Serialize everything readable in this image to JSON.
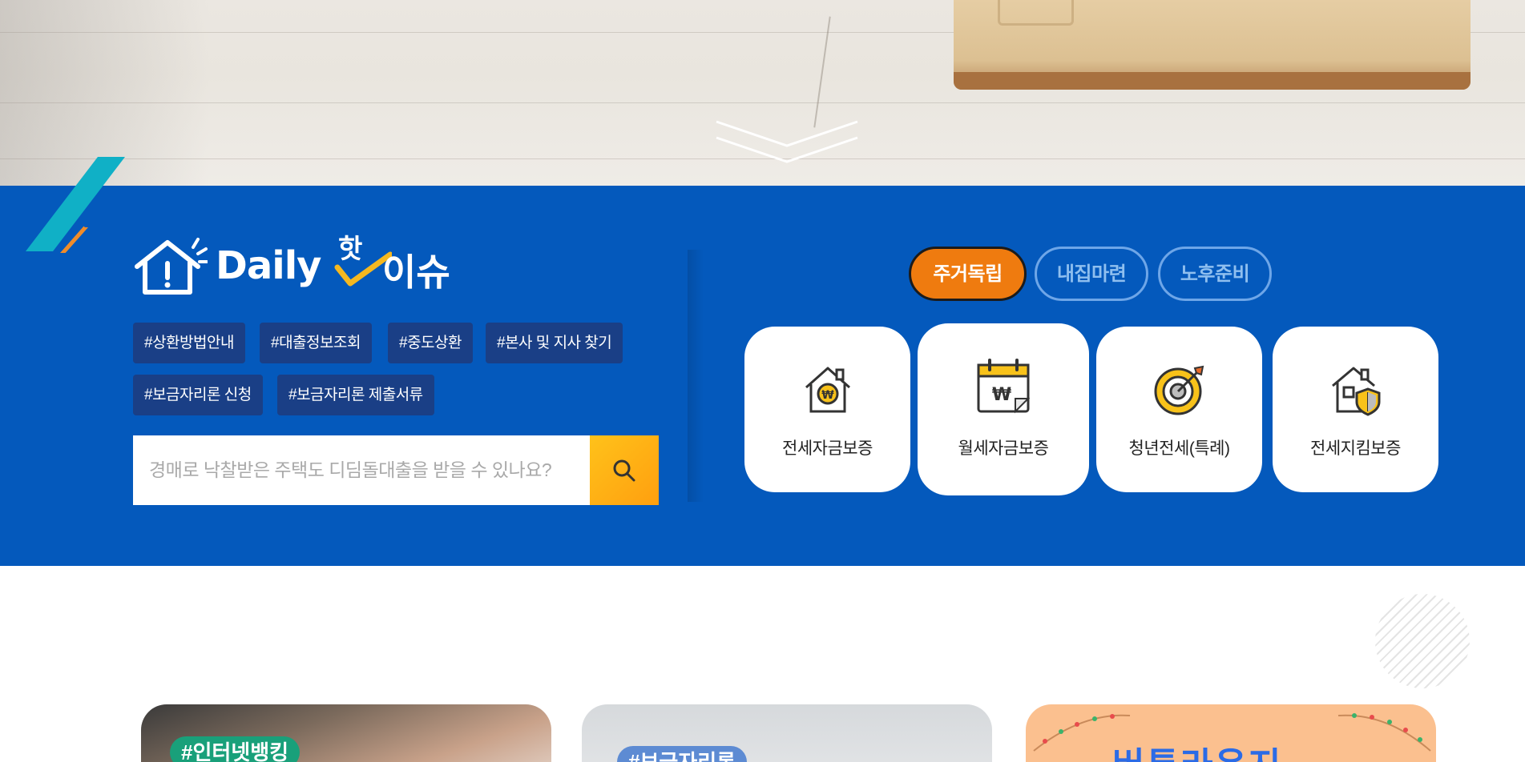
{
  "logo": {
    "daily": "Daily",
    "hot": "핫",
    "issue": "이슈"
  },
  "tags": [
    "#상환방법안내",
    "#대출정보조회",
    "#중도상환",
    "#본사 및 지사 찾기",
    "#보금자리론 신청",
    "#보금자리론 제출서류"
  ],
  "search": {
    "placeholder": "경매로 낙찰받은 주택도 디딤돌대출을 받을 수 있나요?",
    "button_icon": "search-icon"
  },
  "category_tabs": [
    {
      "label": "주거독립",
      "active": true
    },
    {
      "label": "내집마련",
      "active": false
    },
    {
      "label": "노후준비",
      "active": false
    }
  ],
  "cards": [
    {
      "label": "전세자금보증",
      "icon": "house-won-icon"
    },
    {
      "label": "월세자금보증",
      "icon": "calendar-won-icon"
    },
    {
      "label": "청년전세(특례)",
      "icon": "target-icon"
    },
    {
      "label": "전세지킴보증",
      "icon": "house-shield-icon"
    }
  ],
  "promos": [
    {
      "badge": "#인터넷뱅킹"
    },
    {
      "badge": "#보금자리론"
    },
    {
      "title": "버튼라운지"
    }
  ],
  "colors": {
    "band": "#0459bc",
    "active_tab": "#ef7b0f",
    "search_button": "#ffa80f",
    "tag_bg": "#1a3f86"
  }
}
